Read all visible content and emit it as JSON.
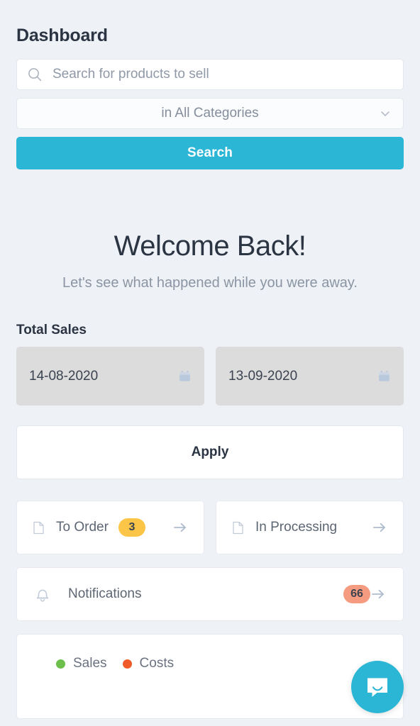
{
  "header": {
    "title": "Dashboard"
  },
  "search": {
    "icon": "search-icon",
    "placeholder": "Search for products to sell",
    "value": "",
    "category_label": "in All Categories",
    "category_chevron": "chevron-down-icon",
    "button_label": "Search",
    "accent_color": "#2ab6d4"
  },
  "welcome": {
    "title": "Welcome Back!",
    "subtitle": "Let's see what happened while you were away."
  },
  "total_sales": {
    "section_title": "Total Sales",
    "date_from": "14-08-2020",
    "date_to": "13-09-2020",
    "calendar_icon": "calendar-icon",
    "apply_label": "Apply"
  },
  "quick_cards": [
    {
      "label": "To Order",
      "icon": "document-icon",
      "badge": "3",
      "badge_color": "#fbc647",
      "arrow": "arrow-right-icon"
    },
    {
      "label": "In Processing",
      "icon": "document-icon",
      "badge": "",
      "badge_color": "",
      "arrow": "arrow-right-icon"
    }
  ],
  "notifications": {
    "icon": "bell-icon",
    "label": "Notifications",
    "badge": "66",
    "badge_color": "#f59b7f",
    "arrow": "arrow-right-icon"
  },
  "chart_data": {
    "type": "line",
    "title": "",
    "legend_position": "top-left",
    "series": [
      {
        "name": "Sales",
        "color": "#6dbf4b",
        "values": []
      },
      {
        "name": "Costs",
        "color": "#f05a28",
        "values": []
      }
    ],
    "categories": [],
    "xlabel": "",
    "ylabel": ""
  },
  "chat": {
    "icon": "chat-bubble-icon",
    "color": "#2ab6d4"
  }
}
